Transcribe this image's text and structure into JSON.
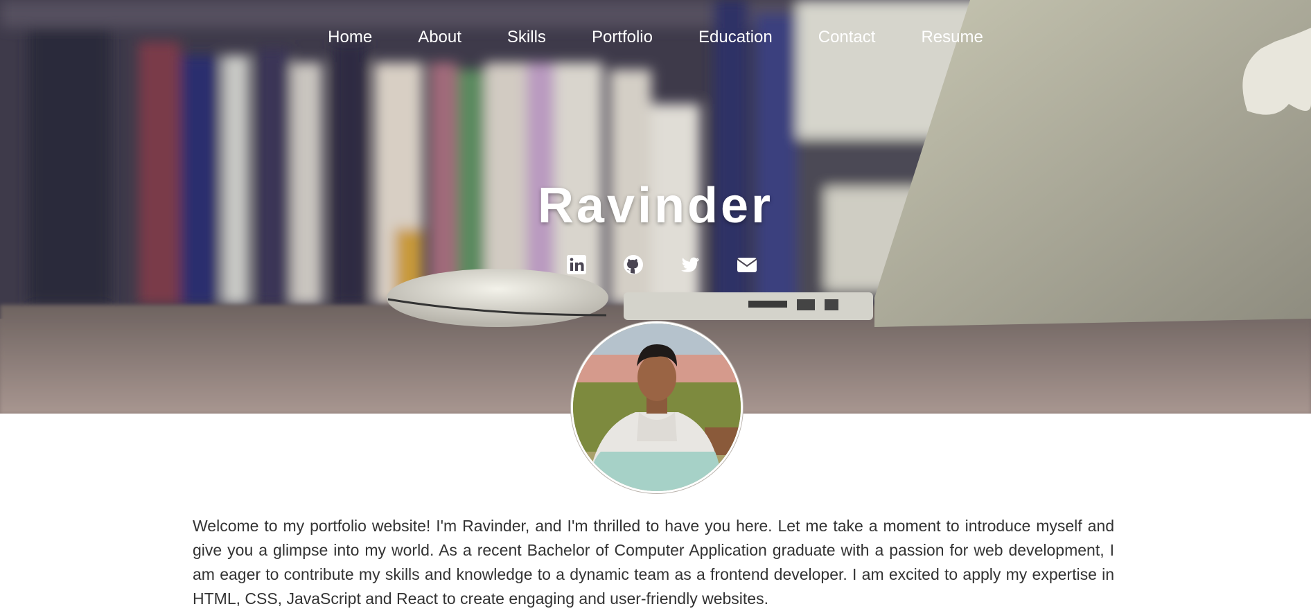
{
  "nav": {
    "items": [
      {
        "label": "Home"
      },
      {
        "label": "About"
      },
      {
        "label": "Skills"
      },
      {
        "label": "Portfolio"
      },
      {
        "label": "Education"
      },
      {
        "label": "Contact"
      },
      {
        "label": "Resume"
      }
    ]
  },
  "hero": {
    "name": "Ravinder",
    "social_icons": [
      "linkedin-icon",
      "github-icon",
      "twitter-icon",
      "envelope-icon"
    ]
  },
  "about": {
    "text": "Welcome to my portfolio website! I'm Ravinder, and I'm thrilled to have you here. Let me take a moment to introduce myself and give you a glimpse into my world. As a recent Bachelor of Computer Application graduate with a passion for web development, I am eager to contribute my skills and knowledge to a dynamic team as a frontend developer. I am excited to apply my expertise in HTML, CSS, JavaScript and React to create engaging and user-friendly websites."
  },
  "colors": {
    "text": "#333333",
    "nav_text": "#ffffff",
    "background": "#ffffff"
  }
}
